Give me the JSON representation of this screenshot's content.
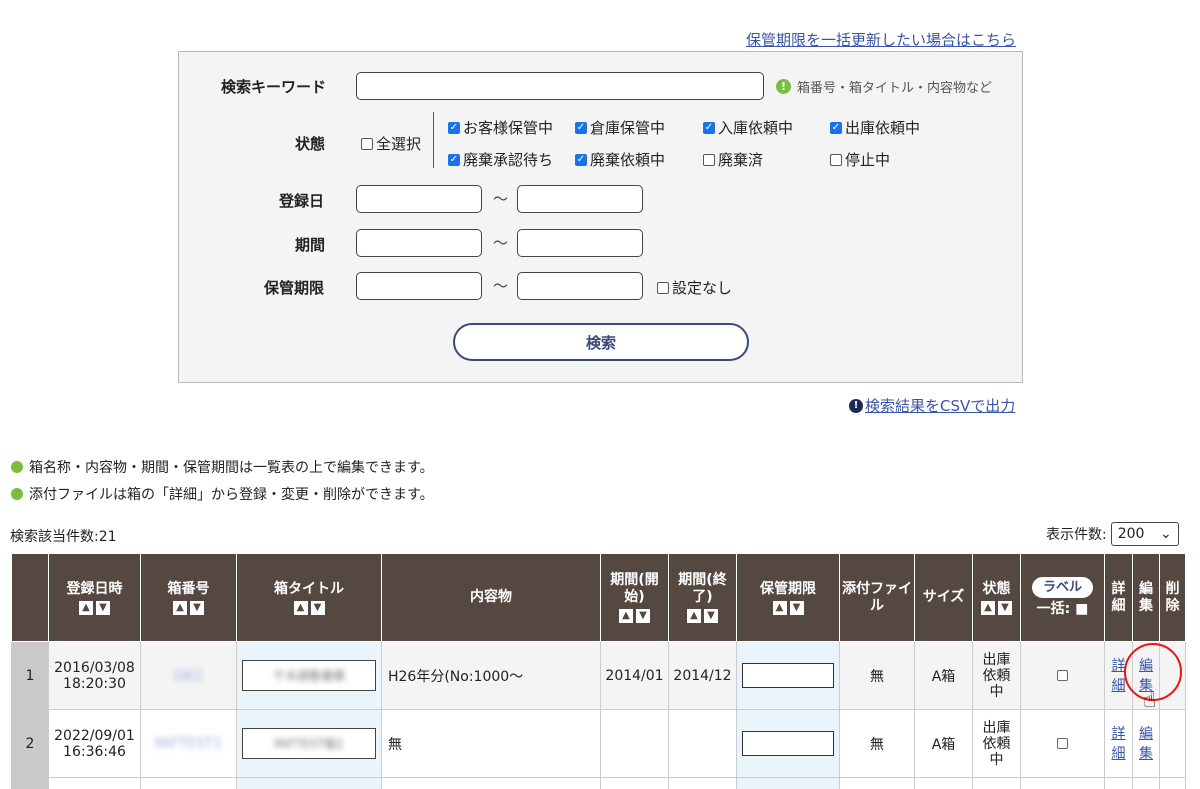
{
  "top_link": "保管期限を一括更新したい場合はこちら",
  "search": {
    "keyword_label": "検索キーワード",
    "keyword_value": "",
    "keyword_hint": "箱番号・箱タイトル・内容物など",
    "status_label": "状態",
    "select_all": "全選択",
    "statuses": [
      {
        "label": "お客様保管中",
        "checked": true
      },
      {
        "label": "倉庫保管中",
        "checked": true
      },
      {
        "label": "入庫依頼中",
        "checked": true
      },
      {
        "label": "出庫依頼中",
        "checked": true
      },
      {
        "label": "廃棄承認待ち",
        "checked": true
      },
      {
        "label": "廃棄依頼中",
        "checked": true
      },
      {
        "label": "廃棄済",
        "checked": false
      },
      {
        "label": "停止中",
        "checked": false
      }
    ],
    "reg_date_label": "登録日",
    "period_label": "期間",
    "retention_label": "保管期限",
    "tilde": "～",
    "no_setting": "設定なし",
    "search_button": "検索"
  },
  "csv_link": "検索結果をCSVで出力",
  "notes": [
    "箱名称・内容物・期間・保管期間は一覧表の上で編集できます。",
    "添付ファイルは箱の「詳細」から登録・変更・削除ができます。"
  ],
  "result_count": "検索該当件数:21",
  "per_page_label": "表示件数:",
  "per_page_value": "200",
  "table": {
    "headers": {
      "reg_datetime": "登録日時",
      "box_number": "箱番号",
      "box_title": "箱タイトル",
      "contents": "内容物",
      "period_start": "期間(開始)",
      "period_end": "期間(終了)",
      "retention": "保管期限",
      "attachment": "添付ファイル",
      "size": "サイズ",
      "status": "状態",
      "label_button": "ラベル",
      "bulk": "一括:",
      "detail": "詳細",
      "edit": "編集",
      "delete": "削除"
    },
    "rows": [
      {
        "no": "1",
        "date": "2016/03/08",
        "time": "18:20:30",
        "box_number": "GK2",
        "box_title": "千木調整書類",
        "contents": "H26年分(No:1000～",
        "start": "2014/01",
        "end": "2014/12",
        "attachment": "無",
        "size": "A箱",
        "status": "出庫依頼中",
        "detail": "詳細",
        "edit": "編集"
      },
      {
        "no": "2",
        "date": "2022/09/01",
        "time": "16:36:46",
        "box_number": "MIFTEST1",
        "box_title": "MIFTEST箱1",
        "contents": "無",
        "start": "",
        "end": "",
        "attachment": "無",
        "size": "A箱",
        "status": "出庫依頼中",
        "detail": "詳細",
        "edit": "編集"
      }
    ]
  }
}
